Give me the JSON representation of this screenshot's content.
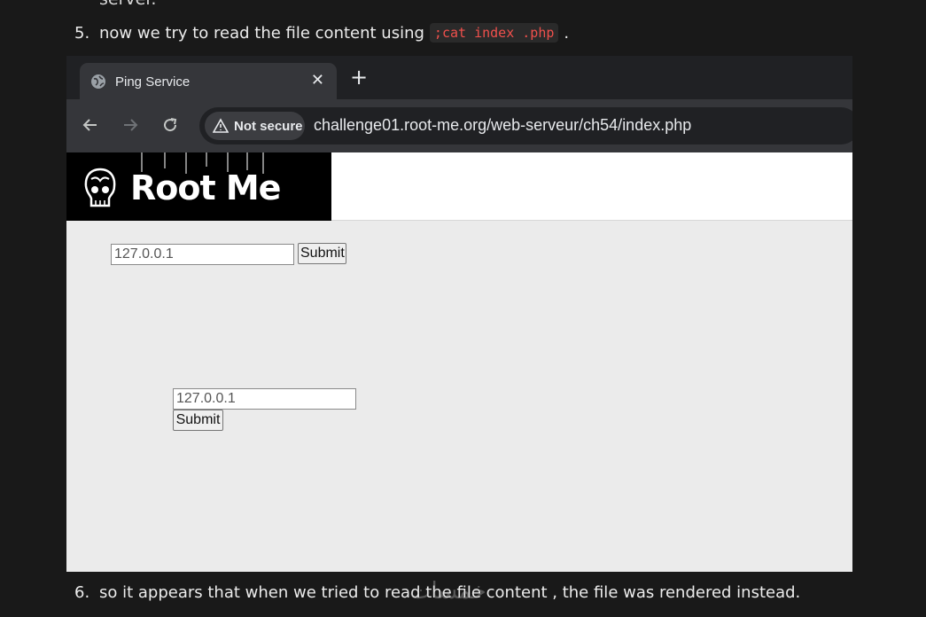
{
  "doc": {
    "partial_line": "server.",
    "steps": [
      {
        "number": "5.",
        "text": "now we try to read the file content using",
        "code": ";cat index .php",
        "suffix": "."
      },
      {
        "number": "6.",
        "text": "so it appears that when we tried to read the file content , the file was rendered instead."
      }
    ],
    "watermark": "خمسات"
  },
  "browser": {
    "tab": {
      "title": "Ping Service",
      "icon": "globe-icon",
      "close_glyph": "✕"
    },
    "new_tab_glyph": "+",
    "toolbar": {
      "back_icon": "arrow-left-icon",
      "forward_icon": "arrow-right-icon",
      "reload_icon": "reload-icon"
    },
    "address_bar": {
      "security_label": "Not secure",
      "url": "challenge01.root-me.org/web-serveur/ch54/index.php"
    }
  },
  "page": {
    "logo_text": "Root Me",
    "forms": [
      {
        "input_value": "127.0.0.1",
        "button_label": "Submit"
      },
      {
        "input_value": "127.0.0.1",
        "button_label": "Submit"
      }
    ]
  },
  "colors": {
    "background": "#191919",
    "code": "#f0504c",
    "chrome_tabstrip": "#202124",
    "chrome_toolbar": "#35363a",
    "page_bg": "#ebebeb"
  }
}
